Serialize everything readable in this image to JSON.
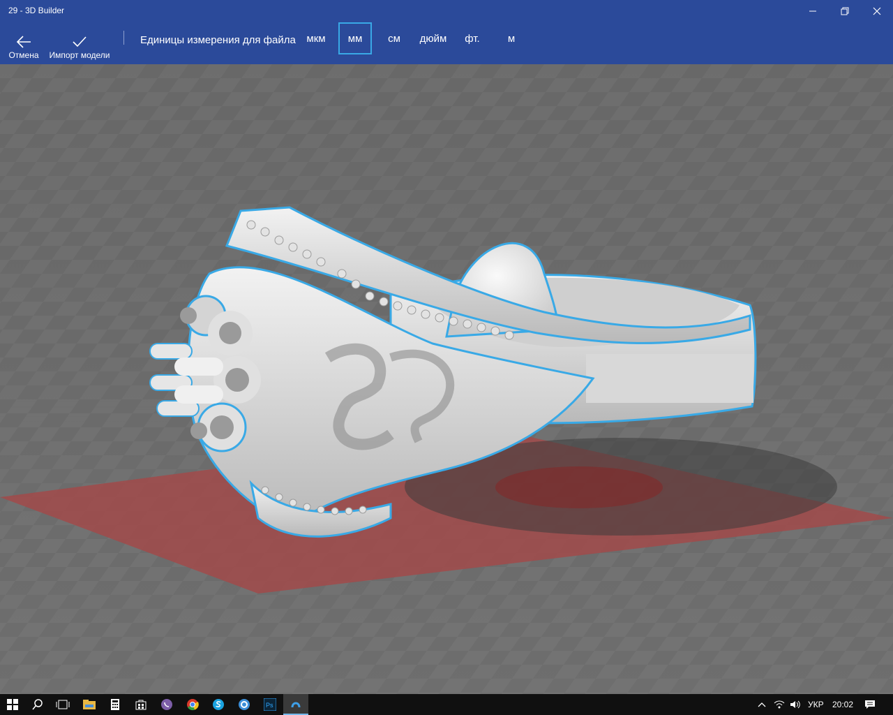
{
  "window": {
    "title": "29 - 3D Builder"
  },
  "commandbar": {
    "cancel_label": "Отмена",
    "import_label": "Импорт модели",
    "units_label": "Единицы измерения для файла",
    "units": [
      "мкм",
      "мм",
      "см",
      "дюйм",
      "фт.",
      "м"
    ],
    "selected_unit": "мм"
  },
  "taskbar": {
    "language": "УКР",
    "time": "20:02",
    "apps": [
      "start-icon",
      "search-icon",
      "task-view-icon",
      "file-explorer-icon",
      "calculator-icon",
      "store-icon",
      "viber-icon",
      "chrome-icon",
      "skype-icon",
      "browser-icon",
      "photoshop-icon",
      "3d-builder-icon"
    ]
  },
  "colors": {
    "accent": "#2b4a9a",
    "selection": "#39a9e6",
    "build_plate": "#a84545"
  }
}
